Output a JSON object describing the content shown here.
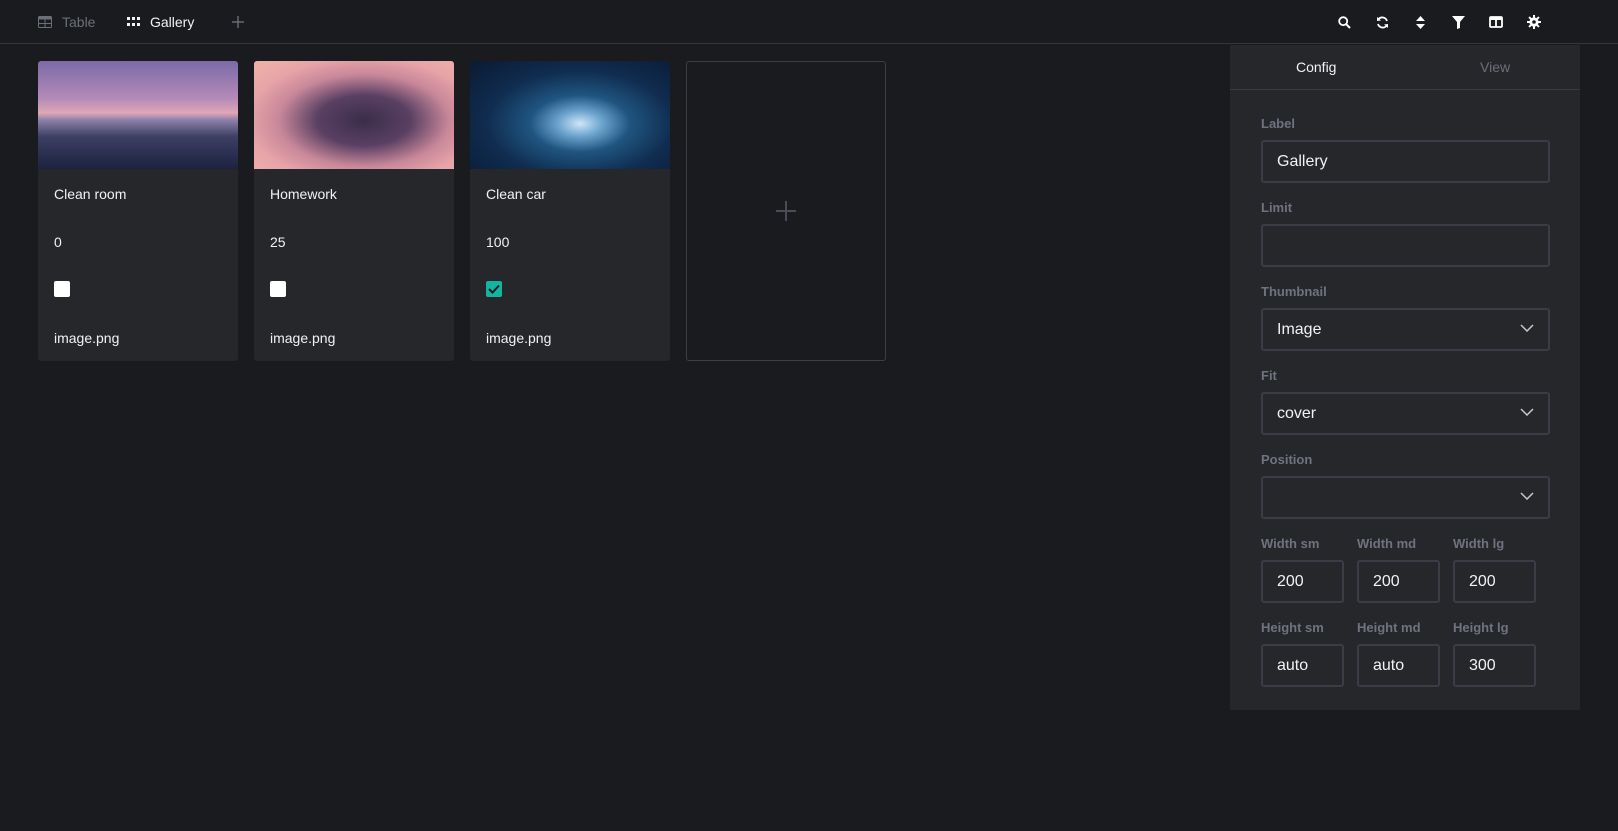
{
  "tabs": [
    {
      "label": "Table",
      "icon": "table-icon"
    },
    {
      "label": "Gallery",
      "icon": "grid-icon"
    }
  ],
  "toolbar": [
    "search-icon",
    "refresh-icon",
    "sort-icon",
    "filter-icon",
    "columns-icon",
    "settings-icon"
  ],
  "cards": [
    {
      "title": "Clean room",
      "value": "0",
      "done": false,
      "file": "image.png"
    },
    {
      "title": "Homework",
      "value": "25",
      "done": false,
      "file": "image.png"
    },
    {
      "title": "Clean car",
      "value": "100",
      "done": true,
      "file": "image.png"
    }
  ],
  "panel": {
    "tabs": {
      "config": "Config",
      "view": "View"
    },
    "label": {
      "title": "Label",
      "value": "Gallery"
    },
    "limit": {
      "title": "Limit",
      "value": ""
    },
    "thumbnail": {
      "title": "Thumbnail",
      "value": "Image"
    },
    "fit": {
      "title": "Fit",
      "value": "cover"
    },
    "position": {
      "title": "Position",
      "value": ""
    },
    "width": {
      "sm": {
        "title": "Width sm",
        "value": "200"
      },
      "md": {
        "title": "Width md",
        "value": "200"
      },
      "lg": {
        "title": "Width lg",
        "value": "200"
      }
    },
    "height": {
      "sm": {
        "title": "Height sm",
        "value": "auto"
      },
      "md": {
        "title": "Height md",
        "value": "auto"
      },
      "lg": {
        "title": "Height lg",
        "value": "300"
      }
    }
  },
  "colors": {
    "background": "#1a1b1e",
    "card": "#26272b",
    "accent": "#12b5a0",
    "muted": "#6b6f78"
  }
}
